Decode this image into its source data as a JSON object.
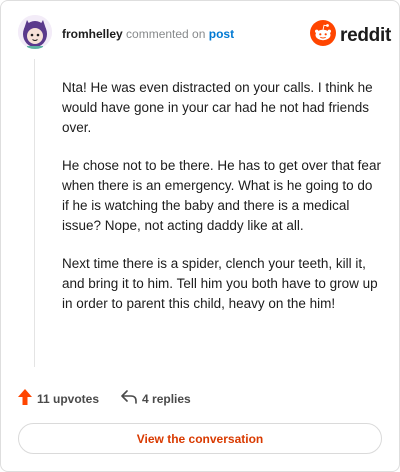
{
  "header": {
    "username": "fromhelley",
    "action_text": "commented on",
    "post_link": "post"
  },
  "brand": {
    "wordmark": "reddit",
    "logo_icon": "reddit-snoo-icon",
    "accent": "#ff4500"
  },
  "comment": {
    "paragraphs": [
      "Nta! He was even distracted on your calls. I think he would have gone in your car had he not had friends over.",
      "He chose not to be there. He has to get over that fear when there is an emergency. What is he going to do if he is watching the baby and there is a medical issue? Nope, not acting daddy like at all.",
      "Next time there is a spider, clench your teeth, kill it, and bring it to him. Tell him you both have to grow up in order to parent this child, heavy on the him!"
    ]
  },
  "actions": {
    "upvotes": "11 upvotes",
    "replies": "4 replies",
    "upvote_icon": "upvote-arrow-icon",
    "reply_icon": "reply-arrow-icon"
  },
  "cta": {
    "label": "View the conversation",
    "color": "#d93a00"
  }
}
